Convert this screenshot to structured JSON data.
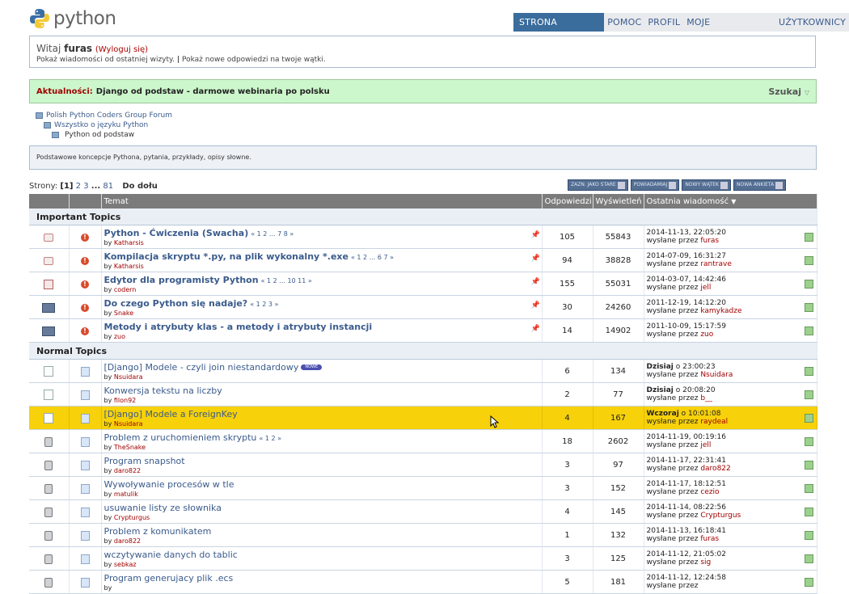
{
  "header": {
    "logo_text": "python",
    "nav": [
      "STRONA GŁÓWNA",
      "POMOC",
      "PROFIL",
      "MOJE WIADOMOŚCI",
      "UŻYTKOWNICY"
    ]
  },
  "welcome": {
    "greeting": "Witaj",
    "user": "furas",
    "logout": "(Wyloguj się)",
    "line2a": "Pokaż wiadomości od ostatniej wizyty.",
    "sep": "|",
    "line2b": "Pokaż nowe odpowiedzi na twoje wątki."
  },
  "news": {
    "label": "Aktualności:",
    "text": "Django od podstaw - darmowe webinaria po polsku",
    "search": "Szukaj"
  },
  "breadcrumb": [
    "Polish Python Coders Group Forum",
    "Wszystko o języku Python",
    "Python od podstaw"
  ],
  "description": "Podstawowe koncepcje Pythona, pytania, przykłady, opisy słowne.",
  "pagination": {
    "label": "Strony:",
    "current": "[1]",
    "p2": "2",
    "p3": "3",
    "dots": "...",
    "last": "81",
    "down": "Do dołu"
  },
  "buttons": [
    "ZAZN. JAKO STARE",
    "POWIADAMIAJ",
    "NOWY WĄTEK",
    "NOWA ANKIETA"
  ],
  "columns": {
    "topic": "Temat",
    "replies": "Odpowiedzi",
    "views": "Wyświetleń",
    "last": "Ostatnia wiadomość"
  },
  "sections": {
    "important": "Important Topics",
    "normal": "Normal Topics"
  },
  "important_topics": [
    {
      "title": "Python - Ćwiczenia (Swacha)",
      "pages": "« 1 2 ... 7 8 »",
      "by": "by",
      "author": "Katharsis",
      "replies": "105",
      "views": "55843",
      "date": "2014-11-13, 22:05:20",
      "posted": "wysłane przez",
      "last_user": "furas"
    },
    {
      "title": "Kompilacja skryptu *.py, na plik wykonalny *.exe",
      "pages": "« 1 2 ... 6 7 »",
      "by": "by",
      "author": "Katharsis",
      "replies": "94",
      "views": "38828",
      "date": "2014-07-09, 16:31:27",
      "posted": "wysłane przez",
      "last_user": "rantrave"
    },
    {
      "title": "Edytor dla programisty Python",
      "pages": "« 1 2 ... 10 11 »",
      "by": "by",
      "author": "codern",
      "replies": "155",
      "views": "55031",
      "date": "2014-03-07, 14:42:46",
      "posted": "wysłane przez",
      "last_user": "jell"
    },
    {
      "title": "Do czego Python się nadaje?",
      "pages": "« 1 2 3 »",
      "by": "by",
      "author": "Snake",
      "replies": "30",
      "views": "24260",
      "date": "2011-12-19, 14:12:20",
      "posted": "wysłane przez",
      "last_user": "kamykadze"
    },
    {
      "title": "Metody i atrybuty klas - a metody i atrybuty instancji",
      "pages": "",
      "by": "by",
      "author": "zuo",
      "replies": "14",
      "views": "14902",
      "date": "2011-10-09, 15:17:59",
      "posted": "wysłane przez",
      "last_user": "zuo"
    }
  ],
  "normal_topics": [
    {
      "title": "[Django] Modele - czyli join niestandardowy",
      "badge": "NOWE",
      "pages": "",
      "by": "by",
      "author": "Nsuidara",
      "replies": "6",
      "views": "134",
      "date_bold": "Dzisiaj",
      "date": "o 23:00:23",
      "posted": "wysłane przez",
      "last_user": "Nsuidara"
    },
    {
      "title": "Konwersja tekstu na liczby",
      "badge": "",
      "pages": "",
      "by": "by",
      "author": "filon92",
      "replies": "2",
      "views": "77",
      "date_bold": "Dzisiaj",
      "date": "o 20:08:20",
      "posted": "wysłane przez",
      "last_user": "b__"
    },
    {
      "title": "[Django] Modele a ForeignKey",
      "badge": "",
      "pages": "",
      "by": "by",
      "author": "Nsuidara",
      "replies": "4",
      "views": "167",
      "date_bold": "Wczoraj",
      "date": "o 10:01:08",
      "posted": "wysłane przez",
      "last_user": "raydeal"
    },
    {
      "title": "Problem z uruchomieniem skryptu",
      "badge": "",
      "pages": "« 1 2 »",
      "by": "by",
      "author": "TheSnake",
      "replies": "18",
      "views": "2602",
      "date_bold": "",
      "date": "2014-11-19, 00:19:16",
      "posted": "wysłane przez",
      "last_user": "jell"
    },
    {
      "title": "Program snapshot",
      "badge": "",
      "pages": "",
      "by": "by",
      "author": "daro822",
      "replies": "3",
      "views": "97",
      "date_bold": "",
      "date": "2014-11-17, 22:31:41",
      "posted": "wysłane przez",
      "last_user": "daro822"
    },
    {
      "title": "Wywoływanie procesów w tle",
      "badge": "",
      "pages": "",
      "by": "by",
      "author": "matulik",
      "replies": "3",
      "views": "152",
      "date_bold": "",
      "date": "2014-11-17, 18:12:51",
      "posted": "wysłane przez",
      "last_user": "cezio"
    },
    {
      "title": "usuwanie listy ze słownika",
      "badge": "",
      "pages": "",
      "by": "by",
      "author": "Crypturgus",
      "replies": "4",
      "views": "145",
      "date_bold": "",
      "date": "2014-11-14, 08:22:56",
      "posted": "wysłane przez",
      "last_user": "Crypturgus"
    },
    {
      "title": "Problem z komunikatem",
      "badge": "",
      "pages": "",
      "by": "by",
      "author": "daro822",
      "replies": "1",
      "views": "132",
      "date_bold": "",
      "date": "2014-11-13, 16:18:41",
      "posted": "wysłane przez",
      "last_user": "furas"
    },
    {
      "title": "wczytywanie danych do tablic",
      "badge": "",
      "pages": "",
      "by": "by",
      "author": "sebkaz",
      "replies": "3",
      "views": "125",
      "date_bold": "",
      "date": "2014-11-12, 21:05:02",
      "posted": "wysłane przez",
      "last_user": "sig"
    },
    {
      "title": "Program generujacy plik .ecs",
      "badge": "",
      "pages": "",
      "by": "by",
      "author": "",
      "replies": "5",
      "views": "181",
      "date_bold": "",
      "date": "2014-11-12, 12:24:58",
      "posted": "wysłane przez",
      "last_user": ""
    }
  ],
  "colors": {
    "accent": "#3a6c9c",
    "highlight": "#f7d10a",
    "news_bg": "#ccf7cc",
    "author": "#a00000"
  }
}
